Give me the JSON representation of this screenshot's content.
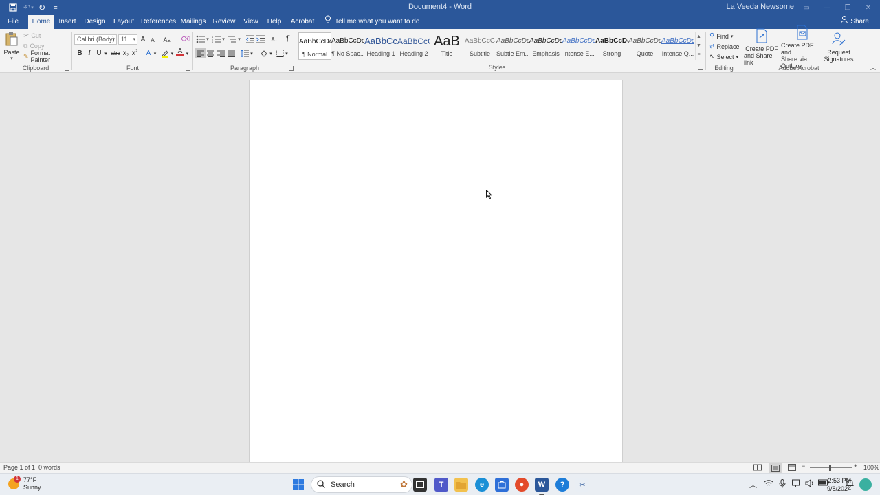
{
  "titlebar": {
    "document_title": "Document4 - Word",
    "user_name": "La Veeda Newsome"
  },
  "tabs": [
    "File",
    "Home",
    "Insert",
    "Design",
    "Layout",
    "References",
    "Mailings",
    "Review",
    "View",
    "Help",
    "Acrobat"
  ],
  "active_tab": "Home",
  "tell_me": "Tell me what you want to do",
  "share_label": "Share",
  "clipboard": {
    "label": "Clipboard",
    "paste": "Paste",
    "cut": "Cut",
    "copy": "Copy",
    "format_painter": "Format Painter"
  },
  "font": {
    "label": "Font",
    "font_name": "Calibri (Body)",
    "font_size": "11",
    "grow": "A",
    "shrink": "A",
    "case": "Aa",
    "bold": "B",
    "italic": "I",
    "underline": "U",
    "strike": "abc",
    "subscript": "x",
    "superscript": "x",
    "effects": "A",
    "font_color": "A"
  },
  "paragraph": {
    "label": "Paragraph",
    "pilcrow": "¶"
  },
  "styles": {
    "label": "Styles",
    "items": [
      {
        "preview": "AaBbCcDc",
        "name": "¶ Normal"
      },
      {
        "preview": "AaBbCcDc",
        "name": "¶ No Spac..."
      },
      {
        "preview": "AaBbCc",
        "name": "Heading 1"
      },
      {
        "preview": "AaBbCcC",
        "name": "Heading 2"
      },
      {
        "preview": "AaB",
        "name": "Title"
      },
      {
        "preview": "AaBbCcC",
        "name": "Subtitle"
      },
      {
        "preview": "AaBbCcDc",
        "name": "Subtle Em..."
      },
      {
        "preview": "AaBbCcDc",
        "name": "Emphasis"
      },
      {
        "preview": "AaBbCcDc",
        "name": "Intense E..."
      },
      {
        "preview": "AaBbCcDc",
        "name": "Strong"
      },
      {
        "preview": "AaBbCcDc",
        "name": "Quote"
      },
      {
        "preview": "AaBbCcDc",
        "name": "Intense Q..."
      }
    ]
  },
  "editing": {
    "label": "Editing",
    "find": "Find",
    "replace": "Replace",
    "select": "Select"
  },
  "acrobat": {
    "label": "Adobe Acrobat",
    "create_pdf_share_1": "Create PDF",
    "create_pdf_share_2": "and Share link",
    "create_pdf_outlook_1": "Create PDF and",
    "create_pdf_outlook_2": "Share via Outlook",
    "request_sig_1": "Request",
    "request_sig_2": "Signatures"
  },
  "status": {
    "page": "Page 1 of 1",
    "words": "0 words",
    "zoom": "100%"
  },
  "taskbar": {
    "weather_temp": "77°F",
    "weather_desc": "Sunny",
    "weather_badge": "1",
    "search": "Search",
    "time": "2:53 PM",
    "date": "9/8/2024"
  }
}
